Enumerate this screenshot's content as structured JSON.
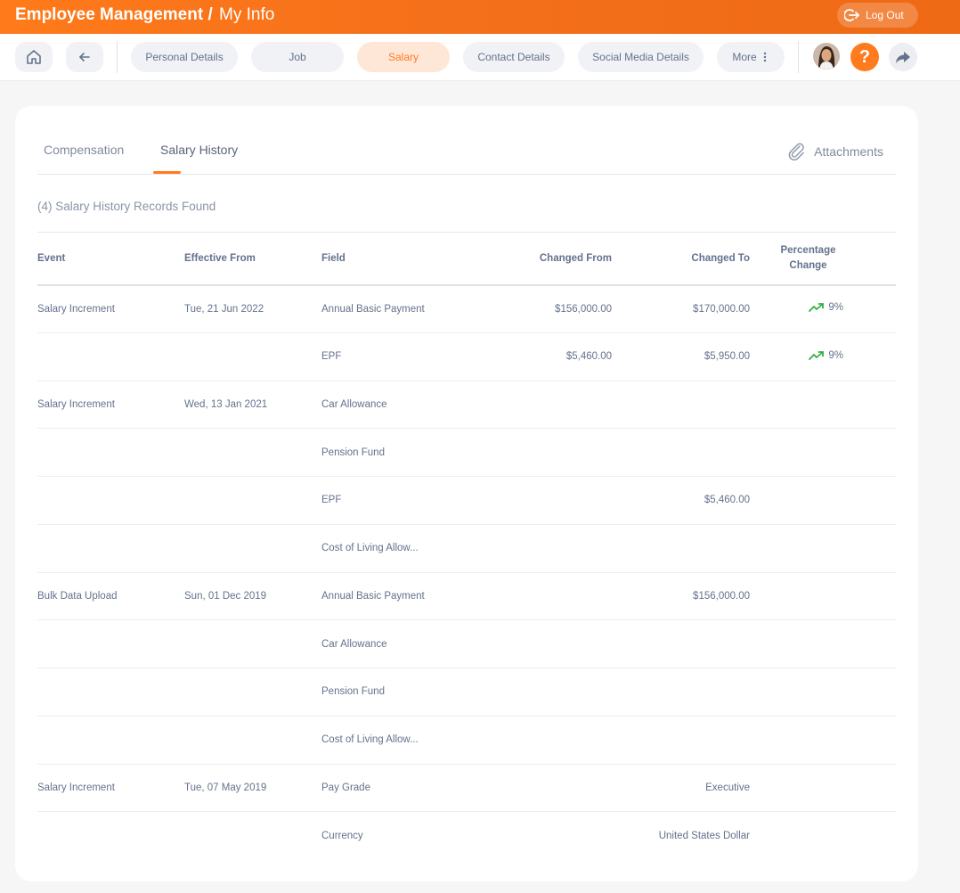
{
  "header": {
    "title": "Employee Management",
    "separator": "/",
    "subtitle": "My Info",
    "logout_label": "Log Out"
  },
  "nav": {
    "home_icon": "home-icon",
    "back_icon": "arrow-left-icon",
    "tabs": [
      {
        "label": "Personal Details",
        "active": false
      },
      {
        "label": "Job",
        "active": false
      },
      {
        "label": "Salary",
        "active": true
      },
      {
        "label": "Contact Details",
        "active": false
      },
      {
        "label": "Social Media Details",
        "active": false
      },
      {
        "label": "More",
        "active": false
      }
    ],
    "help_label": "?"
  },
  "subtabs": {
    "compensation": "Compensation",
    "salary_history": "Salary History",
    "attachments": "Attachments"
  },
  "records_found": "(4) Salary History Records Found",
  "table": {
    "headers": {
      "event": "Event",
      "effective_from": "Effective From",
      "field": "Field",
      "changed_from": "Changed From",
      "changed_to": "Changed To",
      "percentage_line1": "Percentage",
      "percentage_line2": "Change"
    },
    "rows": [
      {
        "event": "Salary Increment",
        "effective": "Tue, 21 Jun 2022",
        "field": "Annual Basic Payment",
        "from": "$156,000.00",
        "to": "$170,000.00",
        "pct": "9%"
      },
      {
        "event": "",
        "effective": "",
        "field": "EPF",
        "from": "$5,460.00",
        "to": "$5,950.00",
        "pct": "9%"
      },
      {
        "event": "Salary Increment",
        "effective": "Wed, 13 Jan 2021",
        "field": "Car Allowance",
        "from": "",
        "to": "",
        "pct": ""
      },
      {
        "event": "",
        "effective": "",
        "field": "Pension Fund",
        "from": "",
        "to": "",
        "pct": ""
      },
      {
        "event": "",
        "effective": "",
        "field": "EPF",
        "from": "",
        "to": "$5,460.00",
        "pct": ""
      },
      {
        "event": "",
        "effective": "",
        "field": "Cost of Living Allow...",
        "from": "",
        "to": "",
        "pct": ""
      },
      {
        "event": "Bulk Data Upload",
        "effective": "Sun, 01 Dec 2019",
        "field": "Annual Basic Payment",
        "from": "",
        "to": "$156,000.00",
        "pct": ""
      },
      {
        "event": "",
        "effective": "",
        "field": "Car Allowance",
        "from": "",
        "to": "",
        "pct": ""
      },
      {
        "event": "",
        "effective": "",
        "field": "Pension Fund",
        "from": "",
        "to": "",
        "pct": ""
      },
      {
        "event": "",
        "effective": "",
        "field": "Cost of Living Allow...",
        "from": "",
        "to": "",
        "pct": ""
      },
      {
        "event": "Salary Increment",
        "effective": "Tue, 07 May 2019",
        "field": "Pay Grade",
        "from": "",
        "to": "Executive",
        "pct": ""
      },
      {
        "event": "",
        "effective": "",
        "field": "Currency",
        "from": "",
        "to": "United States Dollar",
        "pct": ""
      }
    ]
  },
  "colors": {
    "brand_orange": "#ff7b1d",
    "trend_up_green": "#2fb344"
  }
}
